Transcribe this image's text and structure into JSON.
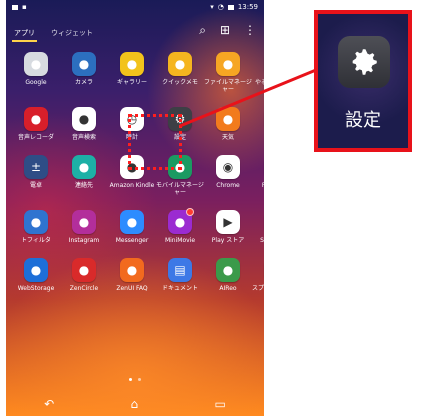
{
  "status": {
    "time": "13:59"
  },
  "tabs": [
    {
      "label": "アプリ"
    },
    {
      "label": "ウィジェット"
    }
  ],
  "apps": [
    {
      "label": "Google",
      "icon": "google-folder-icon",
      "bg": "#d7dbe0"
    },
    {
      "label": "カメラ",
      "icon": "camera-icon",
      "bg": "#2c6fbf"
    },
    {
      "label": "ギャラリー",
      "icon": "gallery-icon",
      "bg": "#f2c31b"
    },
    {
      "label": "クイックメモ",
      "icon": "quick-memo-icon",
      "bg": "#f5b51f"
    },
    {
      "label": "ファイルマネージャー",
      "icon": "file-manager-icon",
      "bg": "#f6a623"
    },
    {
      "label": "やることリスト",
      "icon": "todo-list-icon",
      "bg": "#8a3bbd"
    },
    {
      "label": "音声レコーダ",
      "icon": "voice-recorder-icon",
      "bg": "#d81f2a"
    },
    {
      "label": "音声検索",
      "icon": "voice-search-icon",
      "bg": "#ffffff"
    },
    {
      "label": "時計",
      "icon": "clock-icon",
      "bg": "#ffffff"
    },
    {
      "label": "設定",
      "icon": "settings-icon",
      "bg": "#3d3f45"
    },
    {
      "label": "天気",
      "icon": "weather-icon",
      "bg": "#f27b1d"
    },
    {
      "label": "電子書籍",
      "icon": "ebook-icon",
      "bg": "#3c9b3f"
    },
    {
      "label": "電卓",
      "icon": "calculator-icon",
      "bg": "#2e4d86"
    },
    {
      "label": "連絡先",
      "icon": "contacts-icon",
      "bg": "#1db0a6"
    },
    {
      "label": "Amazon Kindle",
      "icon": "kindle-icon",
      "bg": "#ffffff"
    },
    {
      "label": "モバイルマネージャー",
      "icon": "mobile-manager-icon",
      "bg": "#1b9a62"
    },
    {
      "label": "Chrome",
      "icon": "chrome-icon",
      "bg": "#ffffff"
    },
    {
      "label": "Facebook",
      "icon": "facebook-icon",
      "bg": "#3b5998"
    },
    {
      "label": "トフィルタ",
      "icon": "filter-app-icon",
      "bg": "#2f74d0"
    },
    {
      "label": "Instagram",
      "icon": "instagram-icon",
      "bg": "#b32e9b"
    },
    {
      "label": "Messenger",
      "icon": "messenger-icon",
      "bg": "#2d8cff"
    },
    {
      "label": "MiniMovie",
      "icon": "minimovie-icon",
      "bg": "#9b2bd1"
    },
    {
      "label": "Play ストア",
      "icon": "play-store-icon",
      "bg": "#ffffff"
    },
    {
      "label": "SuperNote",
      "icon": "supernote-icon",
      "bg": "#f0a21d"
    },
    {
      "label": "WebStorage",
      "icon": "webstorage-icon",
      "bg": "#1d6fd8"
    },
    {
      "label": "ZenCircle",
      "icon": "zencircle-icon",
      "bg": "#d92a2a"
    },
    {
      "label": "ZenUI FAQ",
      "icon": "zenui-faq-icon",
      "bg": "#f26a1e"
    },
    {
      "label": "ドキュメント",
      "icon": "documents-icon",
      "bg": "#3d78e6"
    },
    {
      "label": "AIReo",
      "icon": "aireo-icon",
      "bg": "#3b9a4a"
    },
    {
      "label": "スプレッドシート",
      "icon": "spreadsheet-icon",
      "bg": "#1e9e55"
    }
  ],
  "callout": {
    "label": "設定",
    "icon": "settings-icon"
  },
  "accent": "#e8121a"
}
